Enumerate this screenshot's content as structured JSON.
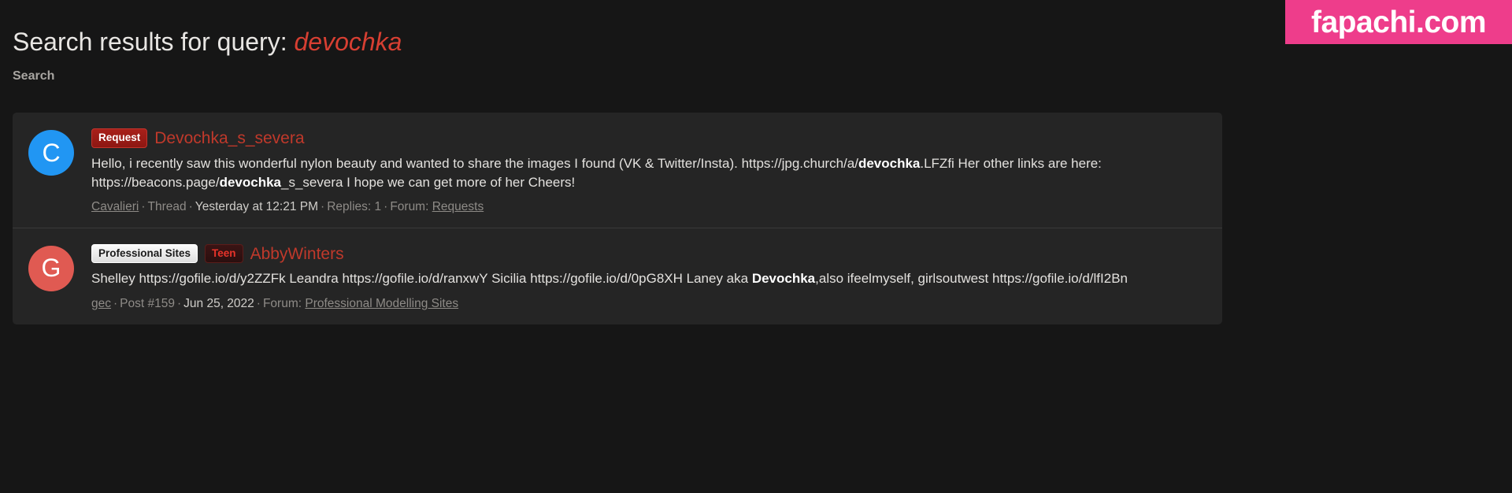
{
  "watermark": {
    "text": "fapachi.com",
    "color": "#ee3d8b"
  },
  "header": {
    "title_prefix": "Search results for query:",
    "query": "devochka"
  },
  "breadcrumb": {
    "label": "Search"
  },
  "results": [
    {
      "avatar_letter": "C",
      "avatar_color": "#2196f3",
      "badges": [
        {
          "label": "Request",
          "style": "request"
        }
      ],
      "title": "Devochka_s_severa",
      "snippet_parts": [
        {
          "text": "Hello, i recently saw this wonderful nylon beauty and wanted to share the images I found (VK & Twitter/Insta). https://jpg.church/a/",
          "bold": false
        },
        {
          "text": "devochka",
          "bold": true
        },
        {
          "text": ".LFZfi Her other links are here: https://beacons.page/",
          "bold": false
        },
        {
          "text": "devochka",
          "bold": true
        },
        {
          "text": "_s_severa I hope we can get more of her Cheers!",
          "bold": false
        }
      ],
      "meta": {
        "author": "Cavalieri",
        "type": "Thread",
        "date": "Yesterday at 12:21 PM",
        "replies": "Replies: 1",
        "forum_label": "Forum:",
        "forum": "Requests"
      }
    },
    {
      "avatar_letter": "G",
      "avatar_color": "#e05a52",
      "badges": [
        {
          "label": "Professional Sites",
          "style": "prosites"
        },
        {
          "label": "Teen",
          "style": "teen"
        }
      ],
      "title": "AbbyWinters",
      "snippet_parts": [
        {
          "text": "Shelley https://gofile.io/d/y2ZZFk Leandra https://gofile.io/d/ranxwY Sicilia https://gofile.io/d/0pG8XH Laney aka ",
          "bold": false
        },
        {
          "text": "Devochka",
          "bold": true
        },
        {
          "text": ",also ifeelmyself, girlsoutwest https://gofile.io/d/lfI2Bn",
          "bold": false
        }
      ],
      "meta": {
        "author": "gec",
        "type": "Post #159",
        "date": "Jun 25, 2022",
        "replies": "",
        "forum_label": "Forum:",
        "forum": "Professional Modelling Sites"
      }
    }
  ]
}
